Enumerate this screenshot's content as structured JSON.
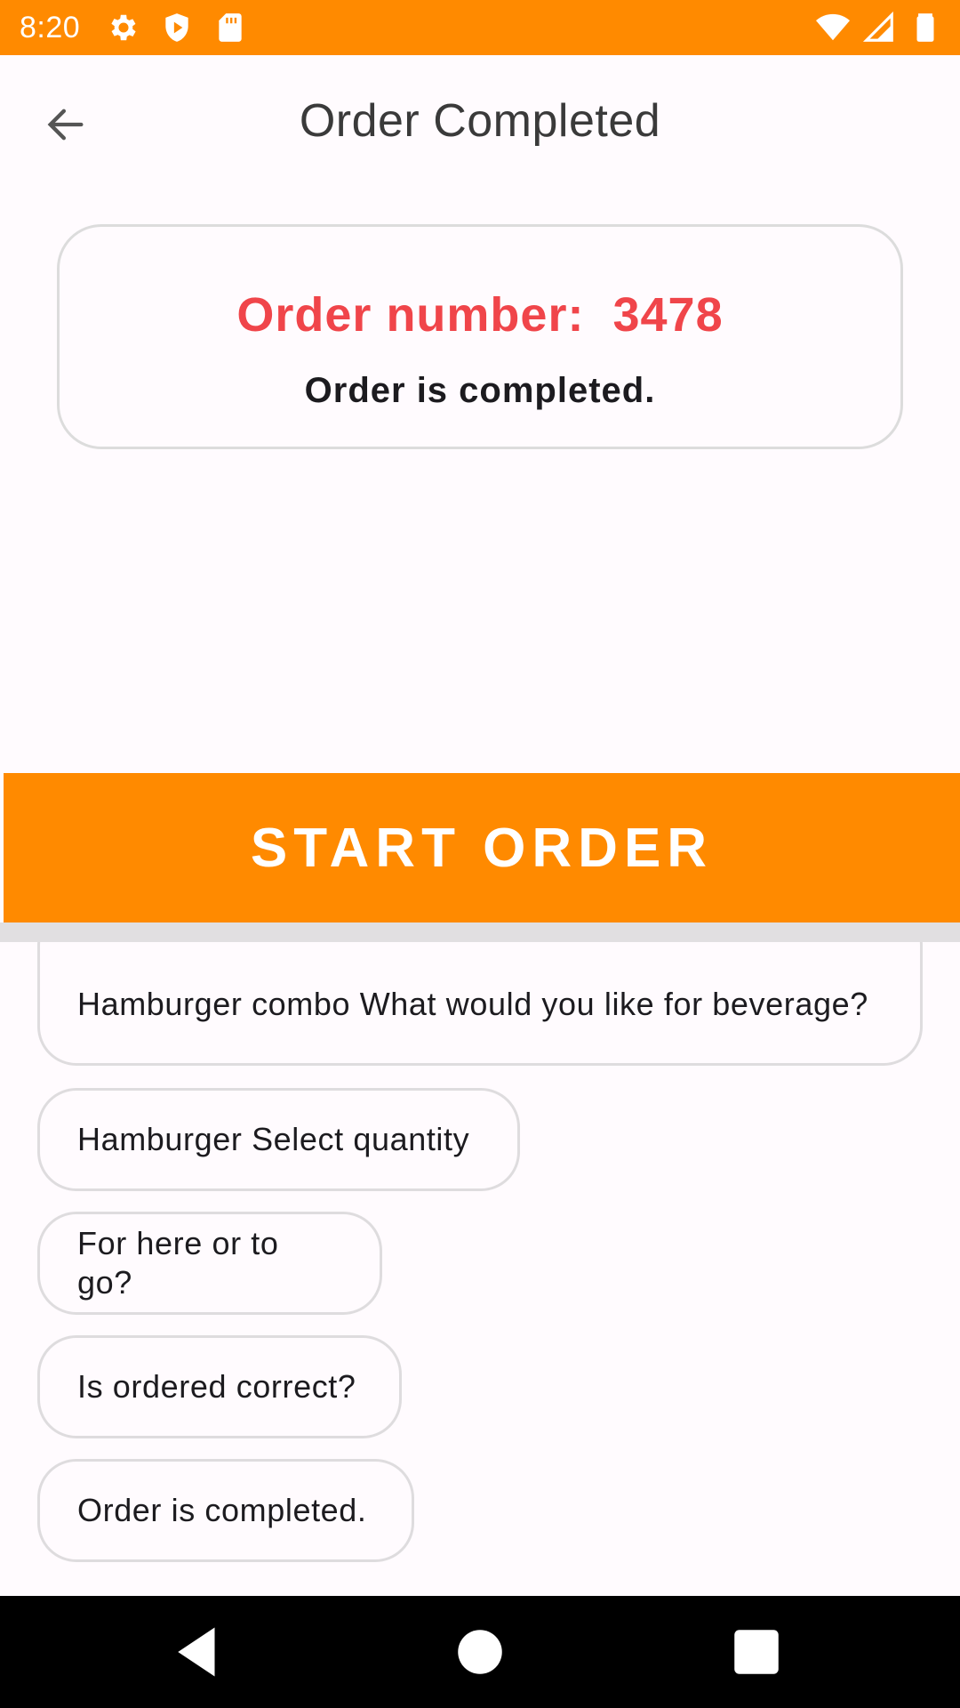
{
  "status_bar": {
    "time": "8:20",
    "left_icons": [
      "gear-icon",
      "shield-icon",
      "sd-card-icon"
    ],
    "right_icons": [
      "wifi-icon",
      "signal-icon",
      "battery-icon"
    ]
  },
  "app_bar": {
    "back_icon": "arrow-back-icon",
    "title": "Order Completed"
  },
  "order_card": {
    "number_label": "Order number:",
    "number_value": "3478",
    "status_text": "Order is completed."
  },
  "start_button": {
    "label": "START ORDER"
  },
  "history": [
    "Hamburger combo What would you like for beverage?",
    "Hamburger Select quantity",
    "For here or to go?",
    "Is ordered correct?",
    "Order is completed."
  ],
  "colors": {
    "accent": "#ff8a00",
    "order_number": "#f0454a",
    "background": "#fffbfe"
  },
  "nav_bar": {
    "icons": [
      "nav-back-icon",
      "nav-home-icon",
      "nav-recents-icon"
    ]
  }
}
